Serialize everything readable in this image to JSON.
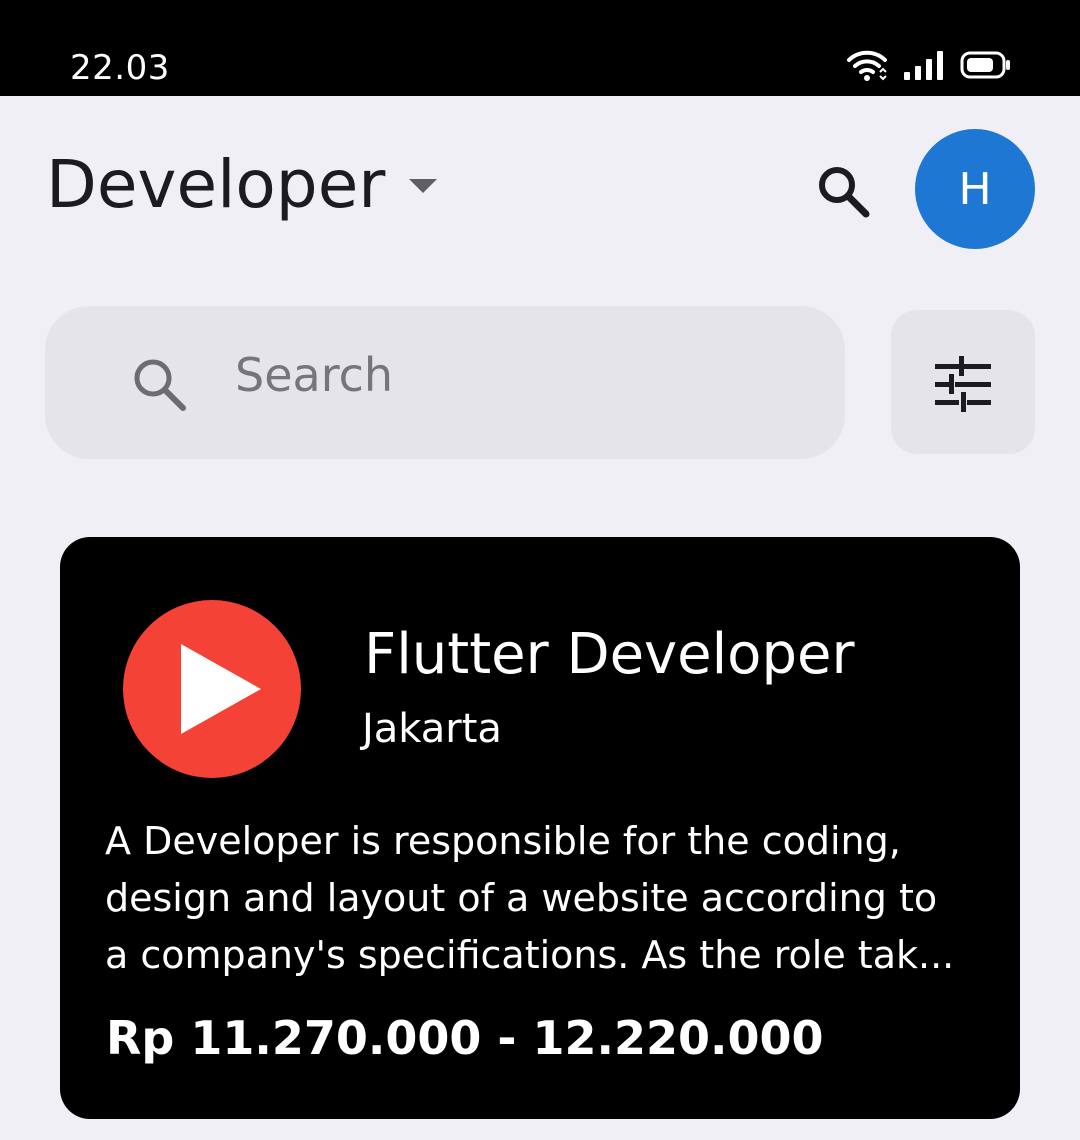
{
  "status_bar": {
    "time": "22.03",
    "icons": [
      "wifi-icon",
      "signal-icon",
      "battery-icon"
    ]
  },
  "header": {
    "title": "Developer",
    "dropdown_icon": "caret-down-icon",
    "search_icon": "search-icon",
    "avatar_initial": "H",
    "avatar_color": "#1e78d3"
  },
  "search": {
    "placeholder": "Search",
    "icon": "search-icon",
    "filter_icon": "tune-icon"
  },
  "jobs": [
    {
      "logo_icon": "play-icon",
      "logo_color": "#f44336",
      "title": "Flutter Developer",
      "location": "Jakarta",
      "description_lines": [
        "A Developer is responsible for the coding,",
        "design and layout of a website according to",
        "a company's specifications. As the role tak..."
      ],
      "salary": "Rp 11.270.000 - 12.220.000"
    }
  ],
  "colors": {
    "background": "#f0eff5",
    "card_background": "#000000",
    "field_background": "#e5e4ea"
  }
}
